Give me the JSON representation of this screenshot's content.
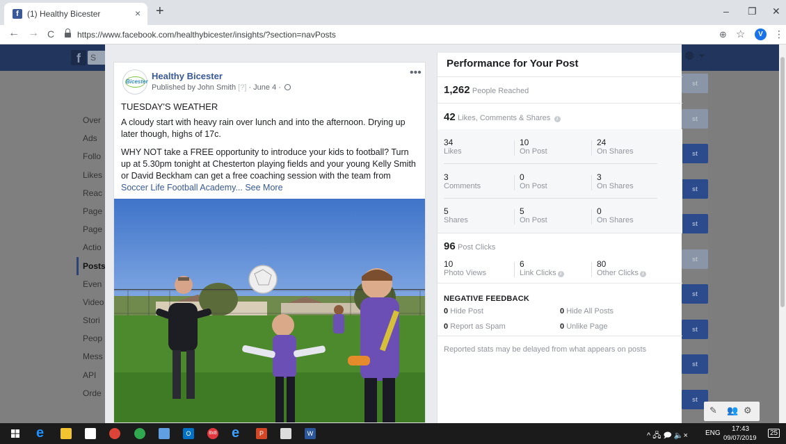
{
  "browser": {
    "tab_title": "(1) Healthy Bicester",
    "tab_close": "×",
    "new_tab": "+",
    "url": "https://www.facebook.com/healthybicester/insights/?section=navPosts",
    "profile_initial": "V",
    "window_controls": {
      "minimize": "–",
      "restore": "❐",
      "close": "✕"
    },
    "nav": {
      "back": "←",
      "forward": "→",
      "reload": "C",
      "zoom": "⊕",
      "star": "☆",
      "menu": "⋮"
    }
  },
  "facebook": {
    "logo": "f",
    "search_stub": "S",
    "sidebar_items": [
      "Over",
      "Ads",
      "Follo",
      "Likes",
      "Reac",
      "Page",
      "Page",
      "Actio",
      "Posts",
      "Even",
      "Video",
      "Stori",
      "Peop",
      "Mess",
      "API",
      "Orde"
    ],
    "right_buttons": [
      "st",
      "st",
      "st",
      "st",
      "st",
      "st",
      "st",
      "st",
      "st",
      "st"
    ]
  },
  "post": {
    "page_name": "Healthy Bicester",
    "avatar_text": "Bicester",
    "published_by": "Published by John Smith",
    "help_marker": "[?]",
    "date": "· June 4 ·",
    "more": "•••",
    "headline": "TUESDAY'S WEATHER",
    "paragraph1": "A cloudy start with heavy rain over lunch and into the afternoon. Drying up later though, highs of 17c.",
    "paragraph2": "WHY NOT take a FREE opportunity to introduce your kids to football? Turn up at 5.30pm tonight at Chesterton playing fields and your young Kelly Smith or David Beckham can get a free coaching session with the team from",
    "link_text": "Soccer Life Football Academy",
    "see_more": "... See More"
  },
  "performance": {
    "title": "Performance for Your Post",
    "reached": {
      "value": "1,262",
      "label": "People Reached"
    },
    "engagement": {
      "value": "42",
      "label": "Likes, Comments & Shares"
    },
    "grid": [
      [
        {
          "n": "34",
          "l": "Likes"
        },
        {
          "n": "10",
          "l": "On Post"
        },
        {
          "n": "24",
          "l": "On Shares"
        }
      ],
      [
        {
          "n": "3",
          "l": "Comments"
        },
        {
          "n": "0",
          "l": "On Post"
        },
        {
          "n": "3",
          "l": "On Shares"
        }
      ],
      [
        {
          "n": "5",
          "l": "Shares"
        },
        {
          "n": "5",
          "l": "On Post"
        },
        {
          "n": "0",
          "l": "On Shares"
        }
      ]
    ],
    "clicks": {
      "value": "96",
      "label": "Post Clicks"
    },
    "clicks_grid": [
      {
        "n": "10",
        "l": "Photo Views"
      },
      {
        "n": "6",
        "l": "Link Clicks"
      },
      {
        "n": "80",
        "l": "Other Clicks"
      }
    ],
    "negative_title": "NEGATIVE FEEDBACK",
    "negative": [
      {
        "n": "0",
        "l": "Hide Post"
      },
      {
        "n": "0",
        "l": "Hide All Posts"
      },
      {
        "n": "0",
        "l": "Report as Spam"
      },
      {
        "n": "0",
        "l": "Unlike Page"
      }
    ],
    "disclaimer": "Reported stats may be delayed from what appears on posts"
  },
  "taskbar": {
    "lang": "ENG",
    "time": "17:43",
    "date": "09/07/2019",
    "notifications": "25",
    "tray": "^ 🖧 🗩 🔈×",
    "app_labels": {
      "outlook": "O",
      "8x8": "8x8",
      "powerpoint": "P",
      "word": "W"
    }
  },
  "colors": {
    "fb_blue": "#385898",
    "muted": "#90949c",
    "taskbar": "#1b1b1b"
  }
}
